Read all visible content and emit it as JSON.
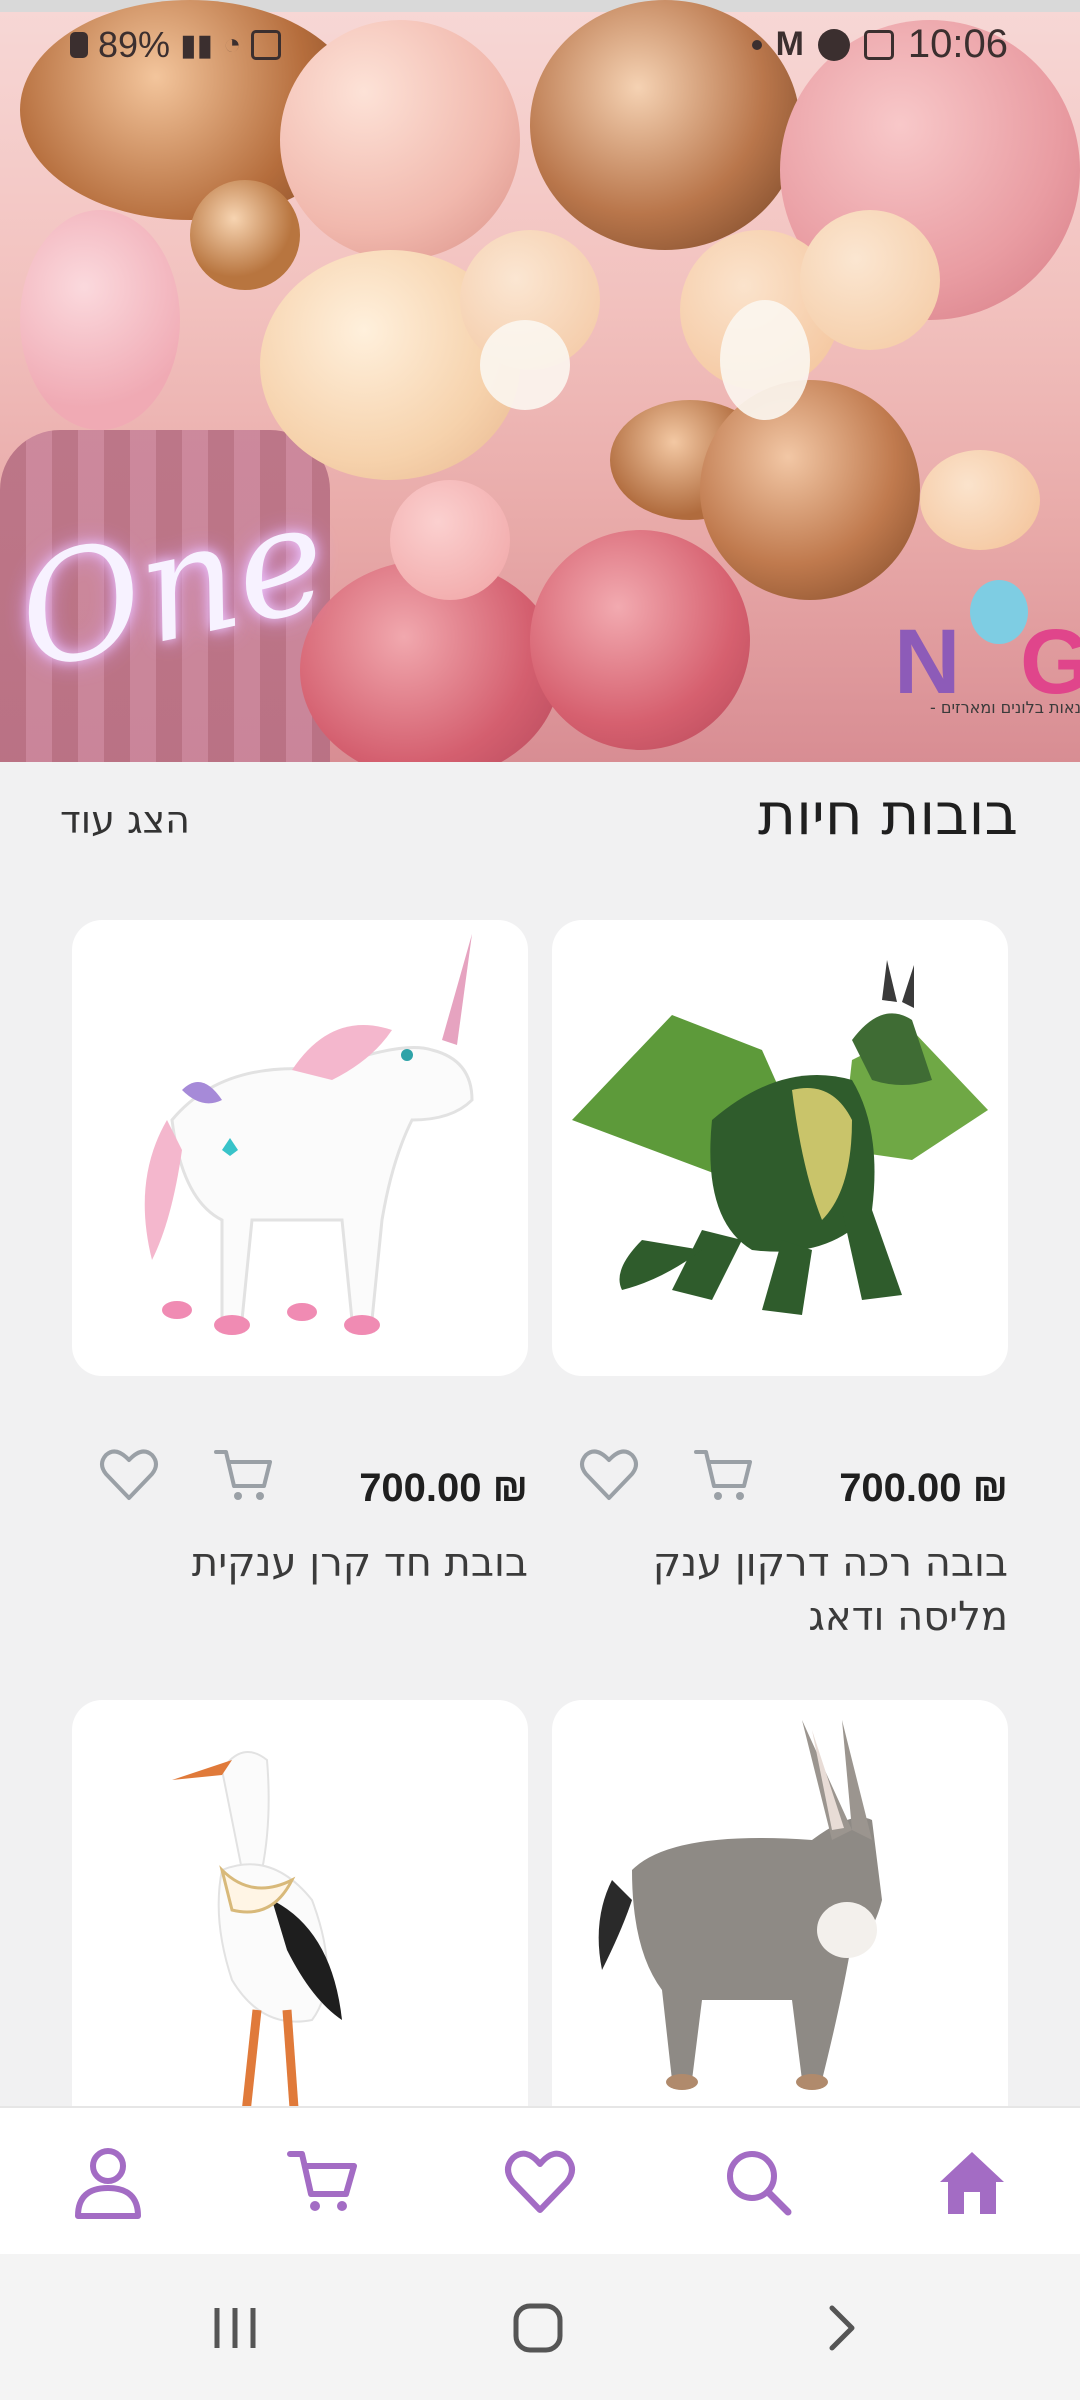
{
  "status_bar": {
    "battery": "89%",
    "time": "10:06"
  },
  "hero": {
    "neon_text": "One",
    "logo_letters": [
      "N",
      "G"
    ],
    "logo_tagline": "נאות בלונים ומארזים -"
  },
  "section": {
    "title": "בובות חיות",
    "show_more": "הצג עוד"
  },
  "products": [
    {
      "name": "בובה רכה דרקון ענק מליסה ודאג",
      "price": "₪ 700.00",
      "image": "green-dragon-plush"
    },
    {
      "name": "בובת חד קרן ענקית",
      "price": "₪ 700.00",
      "image": "white-unicorn-plush"
    },
    {
      "name": "",
      "price": "",
      "image": "donkey-plush"
    },
    {
      "name": "",
      "price": "",
      "image": "stork-plush"
    }
  ],
  "bottom_nav": {
    "items": [
      "home-icon",
      "search-icon",
      "heart-icon",
      "cart-icon",
      "user-icon"
    ],
    "active": "home-icon",
    "accent": "#a36cc4"
  },
  "colors": {
    "accent": "#a36cc4",
    "icon_gray": "#9aa0a6"
  }
}
